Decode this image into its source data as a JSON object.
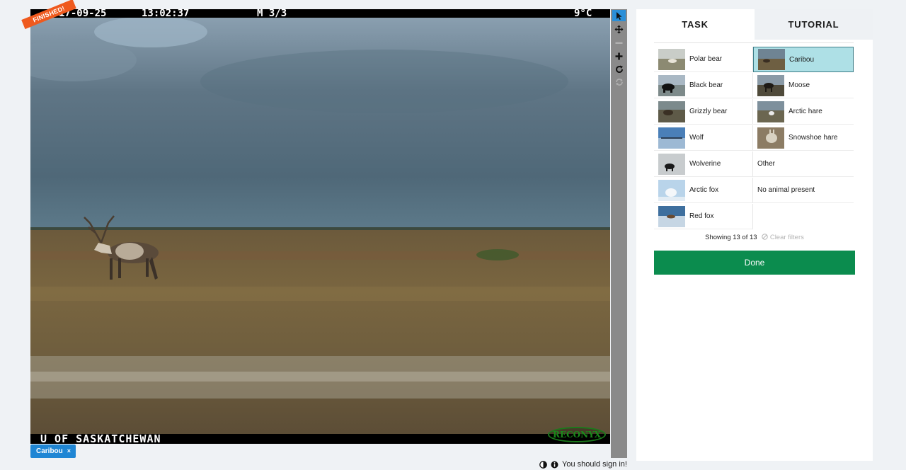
{
  "viewer": {
    "timestamp_left": "17-09-25",
    "timestamp_time": "13:02:37",
    "frame": "M 3/3",
    "temperature": "9°C",
    "credit": "U OF SASKATCHEWAN",
    "camera_logo": "RECONYX",
    "status_ribbon": "FINISHED!",
    "moon_icon": "moon-phase-icon"
  },
  "toolbar": {
    "tools": [
      {
        "name": "pointer-tool",
        "icon": "cursor-arrow-icon",
        "active": true
      },
      {
        "name": "pan-tool",
        "icon": "move-arrows-icon",
        "active": false
      },
      {
        "name": "zoom-out-tool",
        "icon": "minus-icon",
        "active": false
      },
      {
        "name": "zoom-in-tool",
        "icon": "plus-icon",
        "active": false
      },
      {
        "name": "rotate-tool",
        "icon": "rotate-icon",
        "active": false
      },
      {
        "name": "reset-tool",
        "icon": "reset-icon",
        "active": false
      }
    ]
  },
  "annotation_chip": {
    "label": "Caribou",
    "remove": "×"
  },
  "footer": {
    "signin_text": "You should sign in!"
  },
  "tabs": {
    "task": "TASK",
    "tutorial": "TUTORIAL"
  },
  "choices": {
    "left": [
      "Polar bear",
      "Black bear",
      "Grizzly bear",
      "Wolf",
      "Wolverine",
      "Arctic fox",
      "Red fox"
    ],
    "right": [
      "Caribou",
      "Moose",
      "Arctic hare",
      "Snowshoe hare",
      "Other",
      "No animal present"
    ],
    "selected": "Caribou"
  },
  "filter": {
    "showing": "Showing 13 of 13",
    "clear": "Clear filters"
  },
  "done_label": "Done",
  "colors": {
    "accent_blue": "#1f86d4",
    "done_green": "#0b8c4e",
    "selected_bg": "#aee0e6",
    "ribbon": "#ef5a1e"
  }
}
